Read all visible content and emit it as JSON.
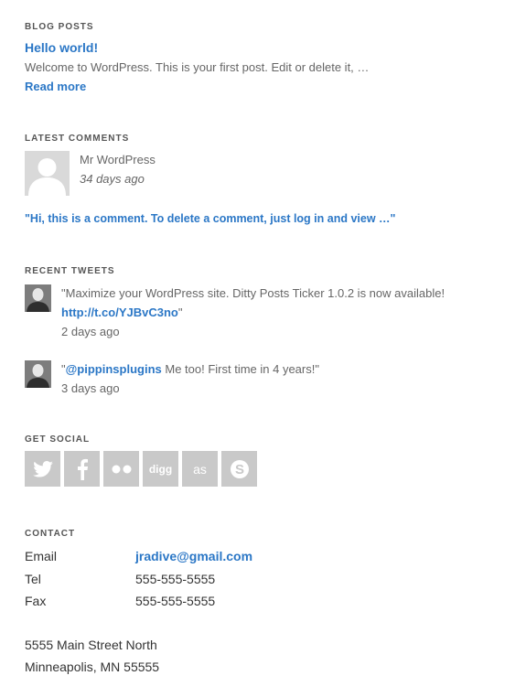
{
  "blog_posts": {
    "heading": "BLOG POSTS",
    "post_title": "Hello world!",
    "excerpt": "Welcome to WordPress. This is your first post. Edit or delete it, …",
    "read_more": "Read more"
  },
  "latest_comments": {
    "heading": "LATEST COMMENTS",
    "author": "Mr WordPress",
    "time": "34 days ago",
    "comment": "\"Hi, this is a comment. To delete a comment, just log in and view …\""
  },
  "recent_tweets": {
    "heading": "RECENT TWEETS",
    "tweets": [
      {
        "text_prefix": "\"Maximize your WordPress site. Ditty Posts Ticker 1.0.2 is now available!",
        "link": "http://t.co/YJBvC3no",
        "text_suffix": "\"",
        "time": "2 days ago"
      },
      {
        "open_quote": "\"",
        "mention": "@pippinsplugins",
        "text": " Me too! First time in 4 years!\"",
        "time": "3 days ago"
      }
    ]
  },
  "get_social": {
    "heading": "GET SOCIAL",
    "icons": [
      "twitter-icon",
      "facebook-icon",
      "flickr-icon",
      "digg-icon",
      "lastfm-icon",
      "skype-icon"
    ],
    "digg_text": "digg",
    "lastfm_text": "as"
  },
  "contact": {
    "heading": "CONTACT",
    "rows": [
      {
        "label": "Email",
        "value": "jradive@gmail.com"
      },
      {
        "label": "Tel",
        "value": "555-555-5555"
      },
      {
        "label": "Fax",
        "value": "555-555-5555"
      }
    ],
    "address_line1": "5555 Main Street North",
    "address_line2": "Minneapolis, MN 55555"
  },
  "colors": {
    "link": "#2b77c6",
    "social_bg": "#c9c9c9"
  }
}
